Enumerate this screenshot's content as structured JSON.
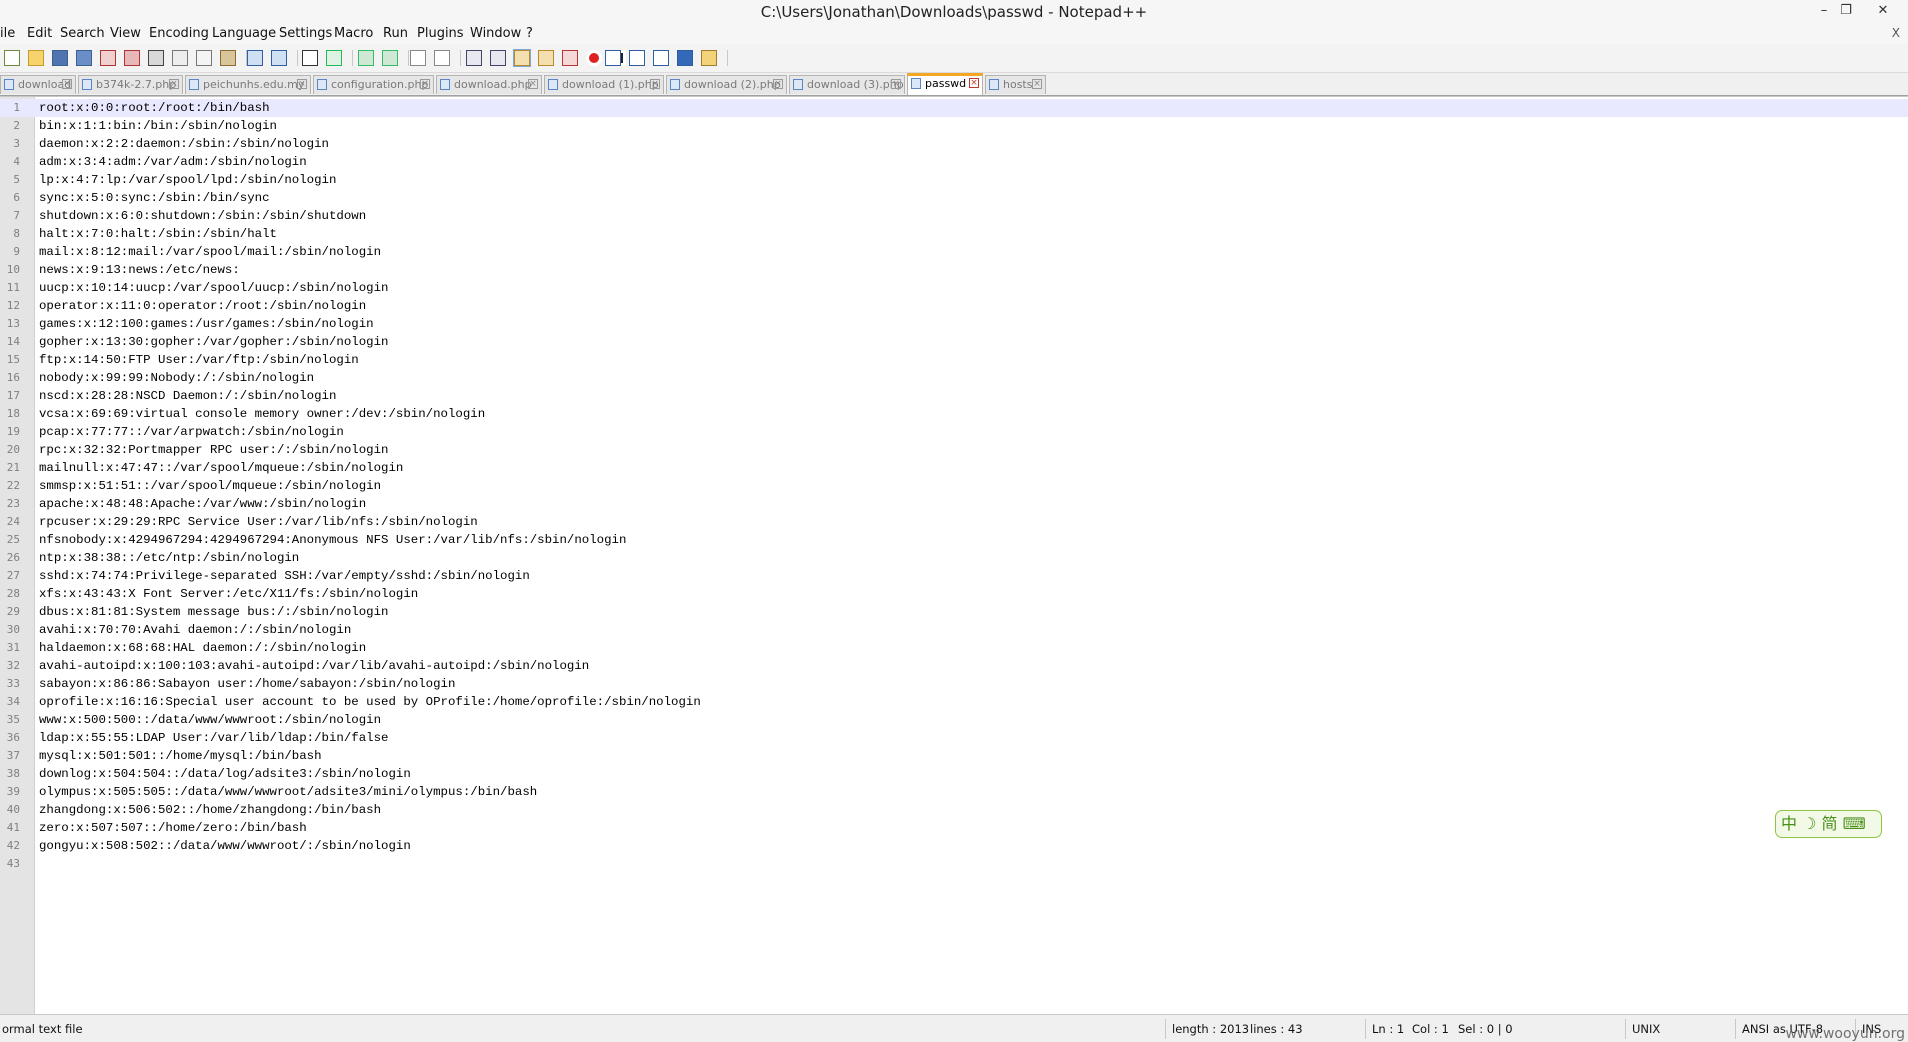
{
  "window": {
    "title": "C:\\Users\\Jonathan\\Downloads\\passwd - Notepad++",
    "minimize": "–",
    "restore": "❐",
    "close": "✕",
    "menu_close": "X"
  },
  "menu": [
    "ile",
    "Edit",
    "Search",
    "View",
    "Encoding",
    "Language",
    "Settings",
    "Macro",
    "Run",
    "Plugins",
    "Window",
    "?"
  ],
  "tabs": [
    "download",
    "b374k-2.7.php",
    "peichunhs.edu.my",
    "configuration.php",
    "download.php",
    "download (1).php",
    "download (2).php",
    "download (3).php",
    "passwd",
    "hosts"
  ],
  "active_tab": "passwd",
  "toolbar_icons": [
    "new-file-icon",
    "open-file-icon",
    "save-icon",
    "save-all-icon",
    "close-icon",
    "close-all-icon",
    "print-icon",
    "cut-icon",
    "copy-icon",
    "paste-icon",
    "undo-icon",
    "redo-icon",
    "find-icon",
    "replace-icon",
    "zoom-in-icon",
    "zoom-out-icon",
    "sync-vertical-icon",
    "sync-horizontal-icon",
    "word-wrap-icon",
    "show-all-chars-icon",
    "indent-guide-icon",
    "doc-map-icon",
    "function-list-icon",
    "folder-workspace-icon",
    "record-macro-icon",
    "stop-record-icon",
    "play-macro-icon",
    "run-macro-multiple-icon",
    "save-macro-icon",
    "spell-check-icon",
    "spell-check-config-icon"
  ],
  "lines": [
    "root:x:0:0:root:/root:/bin/bash",
    "bin:x:1:1:bin:/bin:/sbin/nologin",
    "daemon:x:2:2:daemon:/sbin:/sbin/nologin",
    "adm:x:3:4:adm:/var/adm:/sbin/nologin",
    "lp:x:4:7:lp:/var/spool/lpd:/sbin/nologin",
    "sync:x:5:0:sync:/sbin:/bin/sync",
    "shutdown:x:6:0:shutdown:/sbin:/sbin/shutdown",
    "halt:x:7:0:halt:/sbin:/sbin/halt",
    "mail:x:8:12:mail:/var/spool/mail:/sbin/nologin",
    "news:x:9:13:news:/etc/news:",
    "uucp:x:10:14:uucp:/var/spool/uucp:/sbin/nologin",
    "operator:x:11:0:operator:/root:/sbin/nologin",
    "games:x:12:100:games:/usr/games:/sbin/nologin",
    "gopher:x:13:30:gopher:/var/gopher:/sbin/nologin",
    "ftp:x:14:50:FTP User:/var/ftp:/sbin/nologin",
    "nobody:x:99:99:Nobody:/:/sbin/nologin",
    "nscd:x:28:28:NSCD Daemon:/:/sbin/nologin",
    "vcsa:x:69:69:virtual console memory owner:/dev:/sbin/nologin",
    "pcap:x:77:77::/var/arpwatch:/sbin/nologin",
    "rpc:x:32:32:Portmapper RPC user:/:/sbin/nologin",
    "mailnull:x:47:47::/var/spool/mqueue:/sbin/nologin",
    "smmsp:x:51:51::/var/spool/mqueue:/sbin/nologin",
    "apache:x:48:48:Apache:/var/www:/sbin/nologin",
    "rpcuser:x:29:29:RPC Service User:/var/lib/nfs:/sbin/nologin",
    "nfsnobody:x:4294967294:4294967294:Anonymous NFS User:/var/lib/nfs:/sbin/nologin",
    "ntp:x:38:38::/etc/ntp:/sbin/nologin",
    "sshd:x:74:74:Privilege-separated SSH:/var/empty/sshd:/sbin/nologin",
    "xfs:x:43:43:X Font Server:/etc/X11/fs:/sbin/nologin",
    "dbus:x:81:81:System message bus:/:/sbin/nologin",
    "avahi:x:70:70:Avahi daemon:/:/sbin/nologin",
    "haldaemon:x:68:68:HAL daemon:/:/sbin/nologin",
    "avahi-autoipd:x:100:103:avahi-autoipd:/var/lib/avahi-autoipd:/sbin/nologin",
    "sabayon:x:86:86:Sabayon user:/home/sabayon:/sbin/nologin",
    "oprofile:x:16:16:Special user account to be used by OProfile:/home/oprofile:/sbin/nologin",
    "www:x:500:500::/data/www/wwwroot:/sbin/nologin",
    "ldap:x:55:55:LDAP User:/var/lib/ldap:/bin/false",
    "mysql:x:501:501::/home/mysql:/bin/bash",
    "downlog:x:504:504::/data/log/adsite3:/sbin/nologin",
    "olympus:x:505:505::/data/www/wwwroot/adsite3/mini/olympus:/bin/bash",
    "zhangdong:x:506:502::/home/zhangdong:/bin/bash",
    "zero:x:507:507::/home/zero:/bin/bash",
    "gongyu:x:508:502::/data/www/wwwroot/:/sbin/nologin",
    ""
  ],
  "ime_indicator": "中 ☽ 简 ⌨",
  "status": {
    "type": "ormal text file",
    "length": "length : 2013",
    "lines": "lines : 43",
    "ln": "Ln : 1",
    "col": "Col : 1",
    "sel": "Sel : 0 | 0",
    "eol": "UNIX",
    "encoding": "ANSI as UTF-8",
    "ins": "INS"
  },
  "watermark": "www.wooyun.org",
  "colors": {
    "accent_tab": "#f5a623",
    "current_line": "#e8e8ff",
    "gutter": "#e4e4e4"
  }
}
